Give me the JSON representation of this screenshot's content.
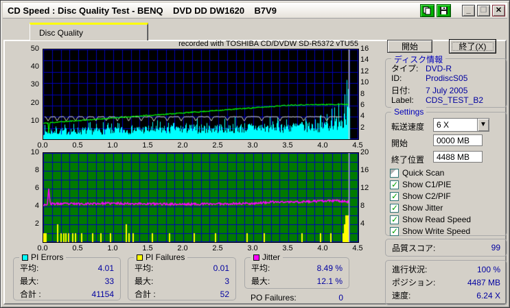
{
  "window": {
    "title": "CD Speed : Disc Quality Test - BENQ    DVD DD DW1620    B7V9"
  },
  "titlebar": {
    "icons": [
      "copy-pages-icon",
      "floppy-save-icon"
    ],
    "minimize": "_",
    "maximize": "",
    "close": "X"
  },
  "tab": {
    "label": "Disc Quality"
  },
  "buttons": {
    "start": "開始",
    "exit": "終了(X)"
  },
  "disc_info": {
    "caption": "ディスク情報",
    "rows": [
      {
        "label": "タイプ:",
        "value": "DVD-R"
      },
      {
        "label": "ID:",
        "value": "ProdiscS05"
      },
      {
        "label": "日付:",
        "value": "7 July 2005"
      },
      {
        "label": "Label:",
        "value": "CDS_TEST_B2"
      }
    ]
  },
  "settings": {
    "caption": "Settings",
    "speed_label": "転送速度",
    "speed_value": "6 X",
    "start_label": "開始",
    "start_value": "0000 MB",
    "end_label": "終了位置",
    "end_value": "4488 MB",
    "checkboxes": [
      {
        "label": "Quick Scan",
        "checked": false,
        "disabled": true
      },
      {
        "label": "Show C1/PIE",
        "checked": true,
        "disabled": false
      },
      {
        "label": "Show C2/PIF",
        "checked": true,
        "disabled": false
      },
      {
        "label": "Show Jitter",
        "checked": true,
        "disabled": false
      },
      {
        "label": "Show Read Speed",
        "checked": true,
        "disabled": false
      },
      {
        "label": "Show Write Speed",
        "checked": true,
        "disabled": false
      }
    ]
  },
  "score": {
    "label": "品質スコア:",
    "value": "99"
  },
  "progress": {
    "rows": [
      {
        "label": "進行状況:",
        "value": "100 %"
      },
      {
        "label": "ポジション:",
        "value": "4487 MB"
      },
      {
        "label": "速度:",
        "value": "6.24 X"
      }
    ]
  },
  "stats": {
    "pi_errors": {
      "caption": "PI Errors",
      "swatch": "#00ffff",
      "rows": [
        [
          "平均:",
          "4.01"
        ],
        [
          "最大:",
          "33"
        ],
        [
          "合計 :",
          "41154"
        ]
      ]
    },
    "pi_failures": {
      "caption": "PI Failures",
      "swatch": "#ffff00",
      "rows": [
        [
          "平均:",
          "0.01"
        ],
        [
          "最大:",
          "3"
        ],
        [
          "合計 :",
          "52"
        ]
      ]
    },
    "jitter": {
      "caption": "Jitter",
      "swatch": "#ff00ff",
      "rows": [
        [
          "平均:",
          "8.49 %"
        ],
        [
          "最大:",
          "12.1 %"
        ]
      ]
    },
    "po_failures": {
      "label": "PO Failures:",
      "value": "0"
    }
  },
  "chart_data": [
    {
      "type": "area",
      "name": "pie-and-speed-chart",
      "annotation": "recorded with TOSHIBA CD/DVDW SD-R5372 vTU55",
      "bg": "#000000",
      "grid_color": "#0000bb",
      "x_axis": {
        "min": 0,
        "max": 4.5,
        "ticks": [
          0.0,
          0.5,
          1.0,
          1.5,
          2.0,
          2.5,
          3.0,
          3.5,
          4.0,
          4.5
        ],
        "grid_step": 0.125
      },
      "left_axis": {
        "min": 0,
        "max": 50,
        "ticks": [
          10,
          20,
          30,
          40,
          50
        ],
        "grid_step": 6.25
      },
      "right_axis": {
        "min": 0,
        "max": 16,
        "ticks": [
          2,
          4,
          6,
          8,
          10,
          12,
          14,
          16
        ]
      },
      "data_end_x": 4.38,
      "series": [
        {
          "name": "PI Errors",
          "type": "noisy_area",
          "color": "#00ffff",
          "axis": "left",
          "seed": 7,
          "envelope_x": [
            0,
            0.5,
            1.0,
            1.5,
            2.0,
            2.5,
            3.0,
            3.5,
            3.8,
            4.0,
            4.1,
            4.2,
            4.27,
            4.33,
            4.375
          ],
          "envelope_y": [
            6,
            6.5,
            7,
            7.5,
            8,
            8.5,
            9,
            9.5,
            10,
            10.5,
            11.5,
            13.5,
            16,
            20,
            20
          ],
          "spikes": [
            [
              4.05,
              14
            ],
            [
              4.12,
              17
            ],
            [
              4.22,
              20
            ],
            [
              4.3,
              25
            ],
            [
              4.33,
              33
            ],
            [
              4.35,
              28
            ]
          ]
        },
        {
          "name": "Write Speed",
          "type": "dip_line",
          "color": "#e0e0e0",
          "axis": "right",
          "seed": 3,
          "base": 4.0,
          "noise": 0.05,
          "x_start": 0.02,
          "x_end": 4.27,
          "dips_x": [
            0.07,
            0.2,
            0.33,
            0.46,
            0.6,
            0.75,
            0.9,
            1.06,
            1.22,
            1.4,
            1.58,
            1.77,
            1.97,
            2.18,
            2.4,
            2.63,
            2.87,
            3.12,
            3.38,
            3.72,
            4.05
          ],
          "dip_depth": 0.75,
          "dip_halfwidth": 0.035
        },
        {
          "name": "Read Speed",
          "type": "noisy_line",
          "color": "#00ff00",
          "axis": "right",
          "seed": 11,
          "x": [
            0,
            0.07,
            0.08,
            0.09,
            3.55,
            4.375
          ],
          "y": [
            2.85,
            2.9,
            0.7,
            2.95,
            6.1,
            6.24
          ],
          "noise": 0.09,
          "width": 1.2
        },
        {
          "name": "end-marker",
          "type": "vline",
          "color": "#c8c8c8",
          "x": 4.365
        }
      ]
    },
    {
      "type": "line",
      "name": "pif-and-jitter-chart",
      "bg": "#007a00",
      "grid_color": "#0000bb",
      "x_axis": {
        "min": 0,
        "max": 4.5,
        "ticks": [
          0.0,
          0.5,
          1.0,
          1.5,
          2.0,
          2.5,
          3.0,
          3.5,
          4.0,
          4.5
        ],
        "grid_step": 0.125
      },
      "left_axis": {
        "min": 0,
        "max": 10,
        "ticks": [
          2,
          4,
          6,
          8,
          10
        ],
        "grid_step": 1
      },
      "right_axis": {
        "min": 0,
        "max": 20,
        "ticks": [
          4,
          8,
          12,
          16,
          20
        ]
      },
      "data_end_x": 4.38,
      "series": [
        {
          "name": "PI Failures",
          "type": "bars",
          "color": "#ffff00",
          "axis": "left",
          "bars": [
            [
              0.005,
              1
            ],
            [
              0.02,
              1
            ],
            [
              0.04,
              1
            ],
            [
              0.21,
              2
            ],
            [
              0.25,
              1
            ],
            [
              0.29,
              1
            ],
            [
              0.32,
              1
            ],
            [
              0.36,
              1
            ],
            [
              0.42,
              1
            ],
            [
              0.46,
              1
            ],
            [
              0.55,
              1
            ],
            [
              0.71,
              1
            ],
            [
              0.82,
              1
            ],
            [
              0.96,
              1
            ],
            [
              1.19,
              2
            ],
            [
              1.23,
              1
            ],
            [
              1.28,
              1
            ],
            [
              1.56,
              1
            ],
            [
              1.8,
              1
            ],
            [
              2.16,
              1
            ],
            [
              2.46,
              1
            ],
            [
              2.91,
              1
            ],
            [
              3.16,
              1
            ],
            [
              3.7,
              1
            ],
            [
              3.96,
              1
            ],
            [
              4.11,
              1
            ],
            [
              4.28,
              1
            ],
            [
              4.3,
              2
            ],
            [
              4.32,
              3
            ],
            [
              4.335,
              3
            ],
            [
              4.35,
              3
            ],
            [
              4.36,
              2
            ]
          ]
        },
        {
          "name": "Jitter",
          "type": "noisy_line",
          "color": "#ff00ff",
          "axis": "left",
          "seed": 23,
          "x": [
            0,
            0.06,
            0.08,
            0.1,
            0.5,
            1.0,
            1.5,
            2.0,
            2.5,
            3.0,
            3.3,
            3.6,
            4.0,
            4.2,
            4.375
          ],
          "y": [
            4.2,
            4.25,
            6.05,
            4.3,
            4.3,
            4.35,
            4.3,
            4.25,
            4.3,
            4.35,
            4.5,
            4.5,
            4.6,
            4.65,
            4.5
          ],
          "noise": 0.12,
          "width": 1.6
        },
        {
          "name": "end-marker",
          "type": "vline",
          "color": "#c8c8c8",
          "x": 4.365
        }
      ]
    }
  ]
}
